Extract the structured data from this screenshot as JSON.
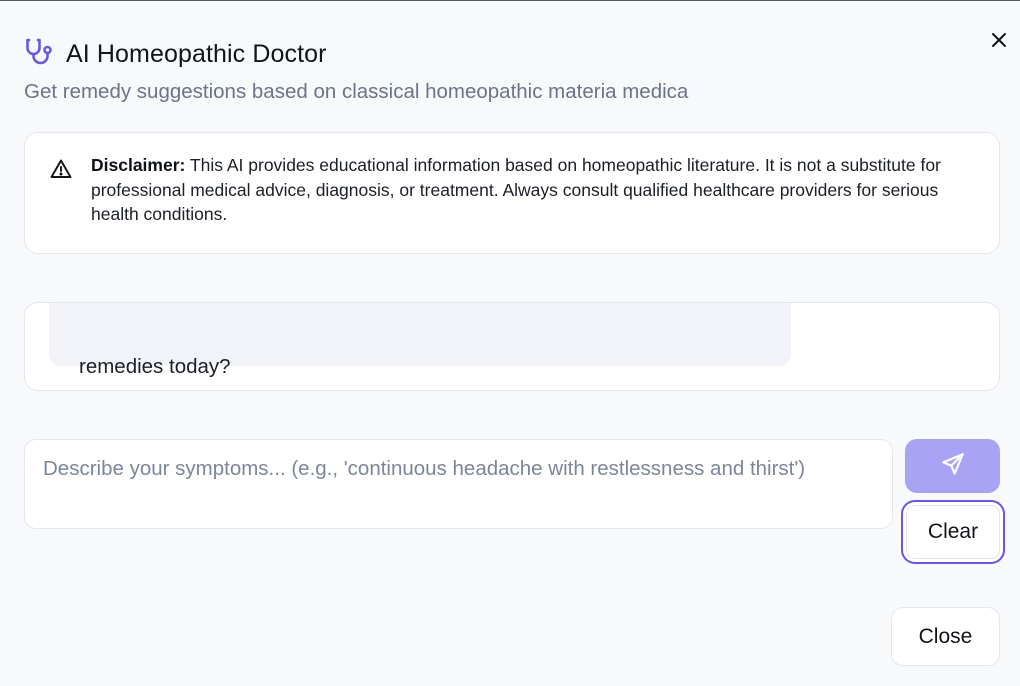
{
  "dialog": {
    "title": "AI Homeopathic Doctor",
    "subtitle": "Get remedy suggestions based on classical homeopathic materia medica",
    "title_icon": "stethoscope-icon",
    "close_icon": "close-icon"
  },
  "disclaimer": {
    "label": "Disclaimer:",
    "text": " This AI provides educational information based on homeopathic literature. It is not a substitute for professional medical advice, diagnosis, or treatment. Always consult qualified healthcare providers for serious health conditions.",
    "icon": "warning-icon"
  },
  "chat": {
    "messages": [
      {
        "role": "assistant",
        "text": "remedies today?"
      }
    ]
  },
  "composer": {
    "placeholder": "Describe your symptoms... (e.g., 'continuous headache with restlessness and thirst')",
    "value": "",
    "send_icon": "send-icon",
    "clear_label": "Clear"
  },
  "footer": {
    "close_label": "Close"
  },
  "colors": {
    "accent": "#6b56e3",
    "send_button": "#a8a3f5",
    "subtitle_text": "#6b7489",
    "background": "#f8f9fb"
  }
}
